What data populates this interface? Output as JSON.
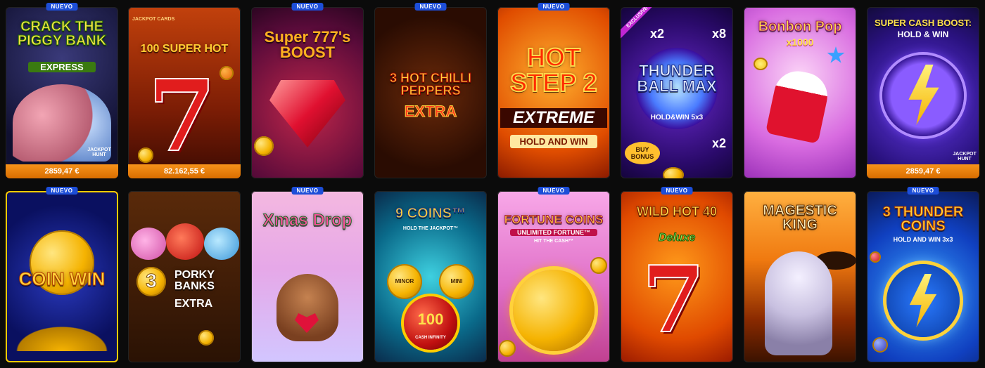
{
  "tiles": [
    {
      "id": "t1",
      "title": "CRACK THE PIGGY BANK",
      "sub": "EXPRESS",
      "badge": "NUEVO",
      "jackpot": "2859,47 €",
      "logo": "JACKPOT HUNT"
    },
    {
      "id": "t2",
      "title": "100 SUPER HOT",
      "sub": "",
      "badge": "",
      "jackpot": "82.162,55 €",
      "logo": "JACKPOT CARDS"
    },
    {
      "id": "t3",
      "title": "Super 777's BOOST",
      "sub": "",
      "badge": "NUEVO",
      "jackpot": ""
    },
    {
      "id": "t4",
      "title": "3 HOT CHILLI PEPPERS",
      "sub": "EXTRA",
      "badge": "NUEVO",
      "jackpot": ""
    },
    {
      "id": "t5",
      "title": "HOT STEP 2",
      "sub": "EXTREME",
      "sub2": "HOLD AND WIN",
      "badge": "NUEVO",
      "jackpot": ""
    },
    {
      "id": "t6",
      "title": "THUNDER BALL MAX",
      "sub": "HOLD&WIN 5x3",
      "badge": "",
      "exclusive": "EXCLUSIVE",
      "jackpot": "",
      "extra": [
        "x2",
        "x8",
        "x2"
      ],
      "bonus": "BUY BONUS"
    },
    {
      "id": "t7",
      "title": "Bonbon Pop",
      "sub": "x1000",
      "badge": "",
      "jackpot": ""
    },
    {
      "id": "t8",
      "title": "SUPER CASH BOOST:",
      "sub": "HOLD & WIN",
      "badge": "",
      "jackpot": "2859,47 €",
      "logo": "JACKPOT HUNT"
    },
    {
      "id": "t9",
      "title": "COIN WIN",
      "sub": "",
      "badge": "NUEVO",
      "jackpot": ""
    },
    {
      "id": "t10",
      "title": "PORKY BANKS",
      "sub": "EXTRA",
      "num": "3",
      "badge": "",
      "jackpot": ""
    },
    {
      "id": "t11",
      "title": "Xmas Drop",
      "sub": "",
      "badge": "NUEVO",
      "jackpot": ""
    },
    {
      "id": "t12",
      "title": "9 COINS™",
      "sub": "HOLD THE JACKPOT™",
      "sub2": "CASH INFINITY",
      "badge": "",
      "jackpot": "",
      "minor": "MINOR",
      "mini": "MINI",
      "big": "100"
    },
    {
      "id": "t13",
      "title": "FORTUNE COINS",
      "sub": "UNLIMITED FORTUNE™",
      "sub2": "HIT THE CASH™",
      "badge": "NUEVO",
      "jackpot": ""
    },
    {
      "id": "t14",
      "title": "WILD HOT 40",
      "sub": "Deluxe",
      "badge": "NUEVO",
      "jackpot": ""
    },
    {
      "id": "t15",
      "title": "MAGESTIC KING",
      "sub": "",
      "badge": "",
      "jackpot": ""
    },
    {
      "id": "t16",
      "title": "3 THUNDER COINS",
      "sub": "HOLD AND WIN 3x3",
      "badge": "NUEVO",
      "jackpot": ""
    }
  ]
}
